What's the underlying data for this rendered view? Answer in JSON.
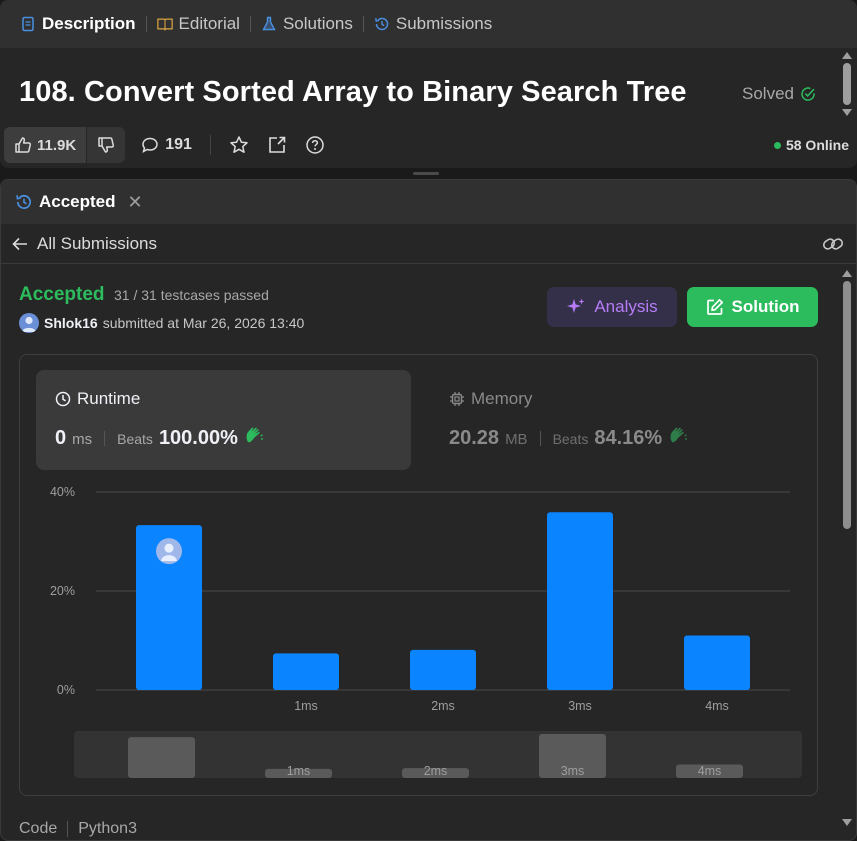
{
  "top_tabs": [
    {
      "label": "Description",
      "icon": "document-icon",
      "color": "#4a90e2"
    },
    {
      "label": "Editorial",
      "icon": "book-icon",
      "color": "#d9a441"
    },
    {
      "label": "Solutions",
      "icon": "flask-icon",
      "color": "#4a90e2"
    },
    {
      "label": "Submissions",
      "icon": "history-icon",
      "color": "#4a90e2"
    }
  ],
  "problem": {
    "title": "108. Convert Sorted Array to Binary Search Tree",
    "status": "Solved"
  },
  "toolbar": {
    "likes": "11.9K",
    "comments": "191",
    "online": "58 Online"
  },
  "submission_tab": {
    "label": "Accepted"
  },
  "nav": {
    "all_submissions": "All Submissions"
  },
  "result": {
    "status": "Accepted",
    "testcases": "31 / 31 testcases passed",
    "user": "Shlok16",
    "submitted_text": "submitted at Mar 26, 2026 13:40"
  },
  "buttons": {
    "analysis": "Analysis",
    "solution": "Solution"
  },
  "runtime": {
    "label": "Runtime",
    "value": "0",
    "unit": "ms",
    "beats_label": "Beats",
    "beats": "100.00%"
  },
  "memory": {
    "label": "Memory",
    "value": "20.28",
    "unit": "MB",
    "beats_label": "Beats",
    "beats": "84.16%"
  },
  "chart_data": {
    "type": "bar",
    "categories": [
      "",
      "1ms",
      "2ms",
      "3ms",
      "4ms"
    ],
    "values": [
      33.3,
      7.4,
      8.1,
      35.9,
      11.0
    ],
    "highlight_index": 0,
    "yticks": [
      "0%",
      "20%",
      "40%"
    ],
    "ylim": [
      0,
      40
    ],
    "grid": true,
    "bar_color": "#0a84ff",
    "overview": {
      "categories": [
        "",
        "1ms",
        "2ms",
        "3ms",
        "4ms"
      ],
      "values": [
        33.3,
        7.4,
        8.1,
        35.9,
        11.0
      ]
    }
  },
  "code_footer": {
    "label": "Code",
    "language": "Python3"
  },
  "colors": {
    "accent_green": "#2cbb5d",
    "accent_blue": "#0a84ff",
    "analysis_purple": "#b57cf6"
  }
}
